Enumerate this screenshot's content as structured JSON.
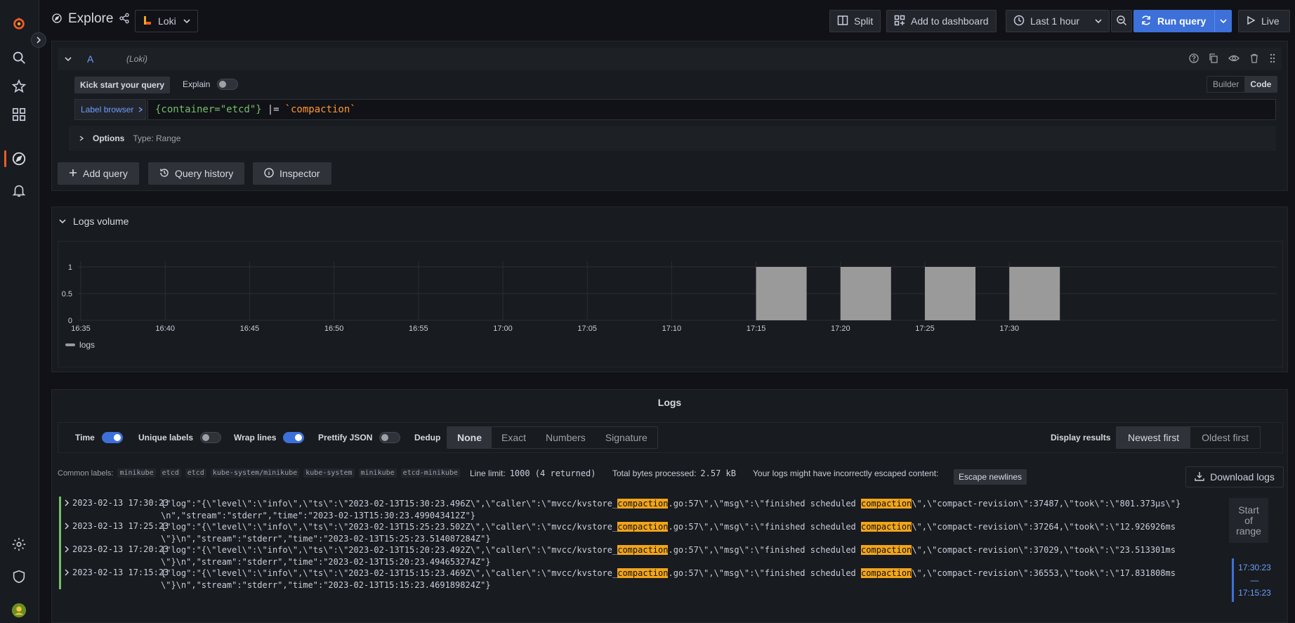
{
  "header": {
    "title": "Explore",
    "datasource": "Loki",
    "split_label": "Split",
    "add_dashboard_label": "Add to dashboard",
    "time_range": "Last 1 hour",
    "run_query_label": "Run query",
    "live_label": "Live"
  },
  "query": {
    "letter": "A",
    "datasource": "(Loki)",
    "kick_start": "Kick start your query",
    "explain_label": "Explain",
    "builder_label": "Builder",
    "code_label": "Code",
    "label_browser": "Label browser",
    "expr_selector": "{container=\"etcd\"}",
    "expr_op": "|=",
    "expr_filter": "`compaction`",
    "options_label": "Options",
    "options_type": "Type: Range",
    "add_query": "Add query",
    "query_history": "Query history",
    "inspector": "Inspector"
  },
  "volume": {
    "title": "Logs volume",
    "legend": "logs"
  },
  "chart_data": {
    "type": "bar",
    "x": [
      "16:35",
      "16:40",
      "16:45",
      "16:50",
      "16:55",
      "17:00",
      "17:05",
      "17:10",
      "17:15",
      "17:20",
      "17:25",
      "17:30"
    ],
    "bars": [
      {
        "time": "17:15",
        "value": 1
      },
      {
        "time": "17:20",
        "value": 1
      },
      {
        "time": "17:25",
        "value": 1
      },
      {
        "time": "17:30",
        "value": 1
      }
    ],
    "y_ticks": [
      "0",
      "0.5",
      "1"
    ],
    "ylim": [
      0,
      1
    ],
    "series": [
      {
        "name": "logs",
        "color": "#9a9a9a"
      }
    ],
    "grid": true,
    "legend_placement": "bottom-left"
  },
  "logs": {
    "title": "Logs",
    "options": {
      "time": "Time",
      "unique_labels": "Unique labels",
      "wrap_lines": "Wrap lines",
      "prettify_json": "Prettify JSON",
      "dedup": "Dedup",
      "dedup_options": [
        "None",
        "Exact",
        "Numbers",
        "Signature"
      ],
      "display_results": "Display results",
      "order_options": [
        "Newest first",
        "Oldest first"
      ]
    },
    "common_labels_title": "Common labels:",
    "common_labels": [
      "minikube",
      "etcd",
      "etcd",
      "kube-system/minikube",
      "kube-system",
      "minikube",
      "etcd-minikube"
    ],
    "line_limit_label": "Line limit:",
    "line_limit_value": "1000 (4 returned)",
    "bytes_label": "Total bytes processed:",
    "bytes_value": "2.57 kB",
    "escape_warning": "Your logs might have incorrectly escaped content:",
    "escape_button": "Escape newlines",
    "download": "Download logs",
    "range_label": [
      "Start",
      "of",
      "range"
    ],
    "range_top": "17:30:23",
    "range_sep": "—",
    "range_bottom": "17:15:23",
    "rows": [
      {
        "ts": "2023-02-13 17:30:23",
        "parts": [
          "{\"log\":\"{\\\"level\\\":\\\"info\\\",\\\"ts\\\":\\\"2023-02-13T15:30:23.496Z\\\",\\\"caller\\\":\\\"mvcc/kvstore_",
          "compaction",
          ".go:57\\\",\\\"msg\\\":\\\"finished scheduled ",
          "compaction",
          "\\\",\\\"compact-revision\\\":37487,\\\"took\\\":\\\"801.373µs\\\"}\\n\",\"stream\":\"stderr\",\"time\":\"2023-02-13T15:30:23.499043412Z\"}"
        ]
      },
      {
        "ts": "2023-02-13 17:25:23",
        "parts": [
          "{\"log\":\"{\\\"level\\\":\\\"info\\\",\\\"ts\\\":\\\"2023-02-13T15:25:23.502Z\\\",\\\"caller\\\":\\\"mvcc/kvstore_",
          "compaction",
          ".go:57\\\",\\\"msg\\\":\\\"finished scheduled ",
          "compaction",
          "\\\",\\\"compact-revision\\\":37264,\\\"took\\\":\\\"12.926926ms\\\"}\\n\",\"stream\":\"stderr\",\"time\":\"2023-02-13T15:25:23.514087284Z\"}"
        ]
      },
      {
        "ts": "2023-02-13 17:20:23",
        "parts": [
          "{\"log\":\"{\\\"level\\\":\\\"info\\\",\\\"ts\\\":\\\"2023-02-13T15:20:23.492Z\\\",\\\"caller\\\":\\\"mvcc/kvstore_",
          "compaction",
          ".go:57\\\",\\\"msg\\\":\\\"finished scheduled ",
          "compaction",
          "\\\",\\\"compact-revision\\\":37029,\\\"took\\\":\\\"23.513301ms\\\"}\\n\",\"stream\":\"stderr\",\"time\":\"2023-02-13T15:20:23.494653274Z\"}"
        ]
      },
      {
        "ts": "2023-02-13 17:15:23",
        "parts": [
          "{\"log\":\"{\\\"level\\\":\\\"info\\\",\\\"ts\\\":\\\"2023-02-13T15:15:23.469Z\\\",\\\"caller\\\":\\\"mvcc/kvstore_",
          "compaction",
          ".go:57\\\",\\\"msg\\\":\\\"finished scheduled ",
          "compaction",
          "\\\",\\\"compact-revision\\\":36553,\\\"took\\\":\\\"17.831808ms\\\"}\\n\",\"stream\":\"stderr\",\"time\":\"2023-02-13T15:15:23.469189824Z\"}"
        ]
      }
    ]
  },
  "colors": {
    "accent": "#3d71d9",
    "highlight": "#f2a51a",
    "log_level": "#73bf69",
    "brand": "#f05a28"
  }
}
